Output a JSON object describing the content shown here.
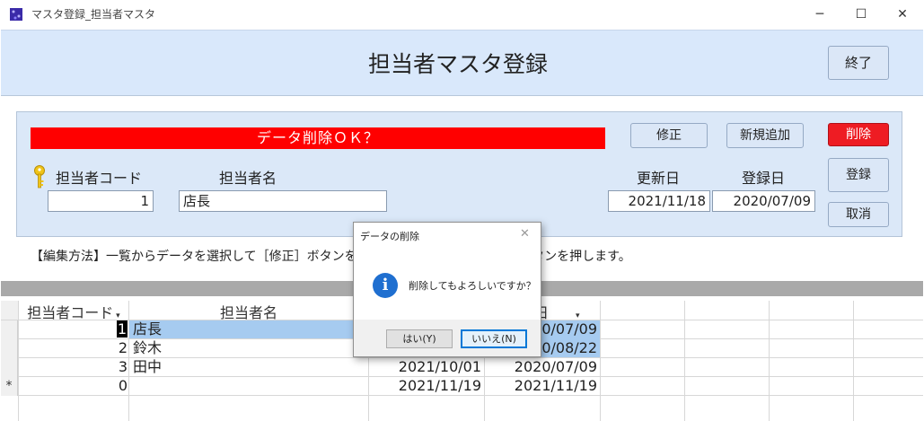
{
  "window": {
    "title": "マスタ登録_担当者マスタ",
    "minimize": "─",
    "maximize": "☐",
    "close": "✕"
  },
  "header": {
    "title": "担当者マスタ登録",
    "exit_label": "終了"
  },
  "detail": {
    "message": "データ削除ＯＫ？",
    "edit_label": "修正",
    "add_label": "新規追加",
    "delete_label": "削除",
    "register_label": "登録",
    "cancel_label": "取消",
    "code_label": "担当者コード",
    "name_label": "担当者名",
    "updated_label": "更新日",
    "registered_label": "登録日",
    "code_value": "1",
    "name_value": "店長",
    "updated_value": "2021/11/18",
    "registered_value": "2020/07/09",
    "accent_delete": "#ee1c23",
    "accent_message": "#ff0000"
  },
  "help": "【編集方法】一覧からデータを選択して［修正］ボタンを押します。編集後は［登録］ボタンを押します。",
  "grid": {
    "headers": [
      "担当者コード",
      "担当者名",
      "日"
    ],
    "rows": [
      {
        "code": "1",
        "name": "店長",
        "updated": "",
        "registered": "0/07/09"
      },
      {
        "code": "2",
        "name": "鈴木",
        "updated": "",
        "registered": "0/08/22"
      },
      {
        "code": "3",
        "name": "田中",
        "updated": "2021/10/01",
        "registered": "2020/07/09"
      },
      {
        "code": "0",
        "name": "",
        "updated": "2021/11/19",
        "registered": "2021/11/19"
      }
    ],
    "new_row_marker": "*"
  },
  "dialog": {
    "title": "データの削除",
    "message": "削除してもよろしいですか？",
    "yes_label": "はい(Y)",
    "no_label": "いいえ(N)",
    "icon": "info-icon"
  }
}
